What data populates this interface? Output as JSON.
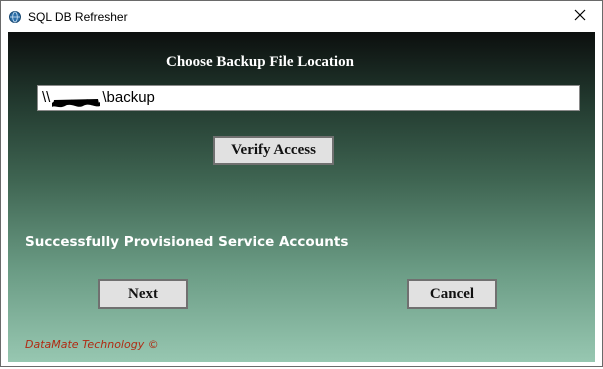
{
  "window": {
    "title": "SQL DB Refresher",
    "app_icon": "app-globe-icon",
    "close_icon": "close-icon"
  },
  "form": {
    "heading": "Choose Backup File Location",
    "backup_path": {
      "prefix": "\\\\",
      "suffix": "\\backup",
      "redacted": true
    },
    "verify_button": "Verify Access",
    "status_message": "Successfully Provisioned Service Accounts",
    "next_button": "Next",
    "cancel_button": "Cancel",
    "footer": "DataMate Technology ©"
  },
  "colors": {
    "gradient_top": "#0c0f0e",
    "gradient_bottom": "#97c7b1",
    "heading_text": "#ffffff",
    "footer_text": "#b02a12",
    "button_face": "#e1e1e1"
  }
}
